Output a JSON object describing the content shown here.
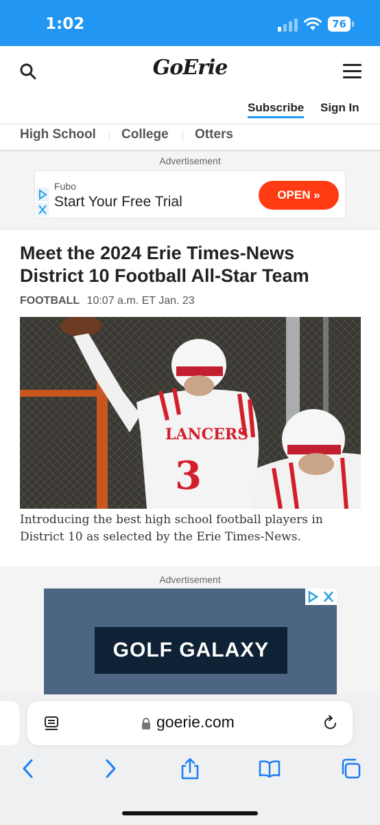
{
  "status_bar": {
    "time": "1:02",
    "battery": "76"
  },
  "header": {
    "logo": "GoErie",
    "subscribe": "Subscribe",
    "sign_in": "Sign In"
  },
  "nav": [
    "High School",
    "College",
    "Otters"
  ],
  "ad1": {
    "label": "Advertisement",
    "brand": "Fubo",
    "text": "Start Your Free Trial",
    "button": "OPEN »"
  },
  "article": {
    "headline": "Meet the 2024 Erie Times-News District 10 Football All-Star Team",
    "category": "FOOTBALL",
    "timestamp": "10:07 a.m. ET Jan. 23",
    "jersey_text": "LANCERS",
    "caption": "Introducing the best high school football players in District 10 as selected by the Erie Times-News."
  },
  "ad2": {
    "label": "Advertisement",
    "brand": "GOLF GALAXY"
  },
  "browser": {
    "url": "goerie.com",
    "icons": [
      "back-icon",
      "forward-icon",
      "share-icon",
      "bookmarks-icon",
      "tabs-icon"
    ]
  },
  "colors": {
    "status_bar": "#2196f3",
    "accent": "#2196f3",
    "cta": "#ff3b13",
    "ad_bg": "#4c6582",
    "golf_box": "#0f2134"
  }
}
